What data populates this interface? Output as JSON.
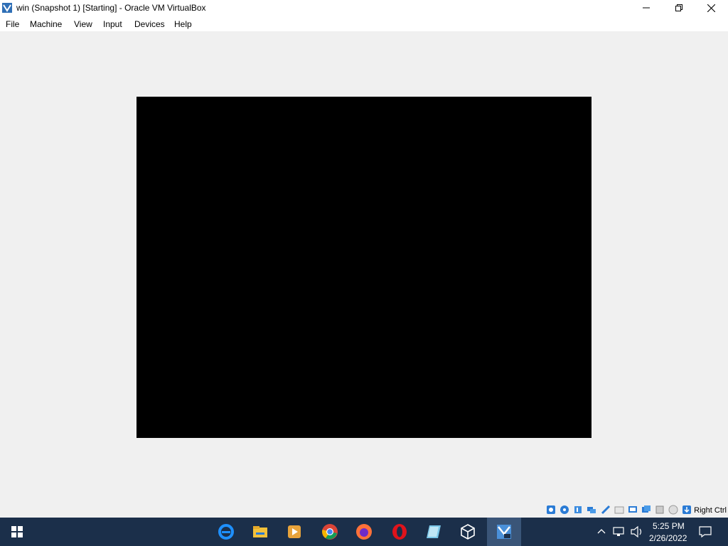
{
  "window": {
    "title": "win (Snapshot 1) [Starting] - Oracle VM VirtualBox",
    "icon": "virtualbox-icon",
    "controls": [
      "minimize-icon",
      "restore-icon",
      "close-icon"
    ]
  },
  "menubar": {
    "items": [
      {
        "label": "File"
      },
      {
        "label": "Machine"
      },
      {
        "label": "View"
      },
      {
        "label": "Input"
      },
      {
        "label": "Devices"
      },
      {
        "label": "Help"
      }
    ]
  },
  "statusbar": {
    "icons": [
      "hard-disk-icon",
      "optical-drive-icon",
      "audio-icon",
      "network-icon",
      "usb-icon",
      "shared-folders-icon",
      "display-icon",
      "recording-icon",
      "cpu-icon",
      "mouse-integration-icon",
      "keyboard-capture-icon"
    ],
    "host_key": "Right Ctrl"
  },
  "taskbar": {
    "start_icon": "windows-start-icon",
    "apps": [
      {
        "name": "internet-explorer-icon",
        "color": "#1e90ff"
      },
      {
        "name": "file-explorer-icon",
        "color": "#f3c13a"
      },
      {
        "name": "media-player-icon",
        "color": "#e8a33b"
      },
      {
        "name": "chrome-icon",
        "color": "#db4437"
      },
      {
        "name": "firefox-icon",
        "color": "#ff7139"
      },
      {
        "name": "opera-icon",
        "color": "#e0131b"
      },
      {
        "name": "notepad-icon",
        "color": "#7ac7e8"
      },
      {
        "name": "virtualbox-icon",
        "color": "#ffffff"
      },
      {
        "name": "vm-window-icon",
        "color": "#4a90d9",
        "active": true
      }
    ],
    "tray": {
      "icons": [
        "chevron-up-icon",
        "network-tray-icon",
        "volume-icon"
      ],
      "time": "5:25 PM",
      "date": "2/26/2022",
      "notification_icon": "notification-icon"
    },
    "color": "#1b2f4a"
  }
}
